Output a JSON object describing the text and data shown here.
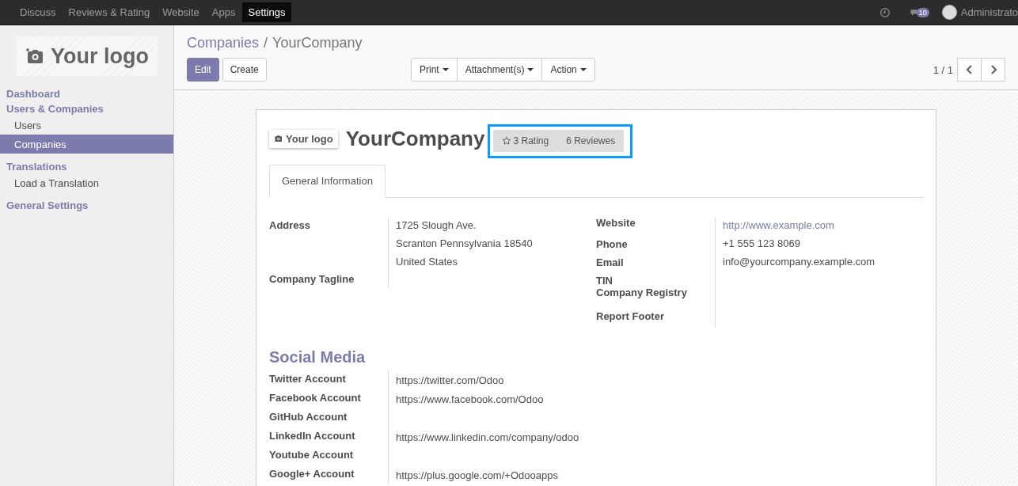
{
  "top_menu": [
    {
      "label": "Discuss",
      "selected": false
    },
    {
      "label": "Reviews & Rating",
      "selected": false
    },
    {
      "label": "Website",
      "selected": false
    },
    {
      "label": "Apps",
      "selected": false
    },
    {
      "label": "Settings",
      "selected": true
    }
  ],
  "systray": {
    "message_count": "10",
    "user": "Administrato"
  },
  "sidebar": {
    "logo_text": "Your logo",
    "sections": [
      {
        "title": "Dashboard"
      },
      {
        "title": "Users & Companies",
        "items": [
          {
            "label": "Users",
            "selected": false
          },
          {
            "label": "Companies",
            "selected": true
          }
        ]
      },
      {
        "title": "Translations",
        "items": [
          {
            "label": "Load a Translation",
            "selected": false
          }
        ]
      },
      {
        "title": "General Settings"
      }
    ]
  },
  "breadcrumb": {
    "parent": "Companies",
    "separator": "/",
    "current": "YourCompany"
  },
  "buttons": [
    "Edit",
    "Create"
  ],
  "dropdowns": [
    "Print",
    "Attachment(s)",
    "Action"
  ],
  "pager": "1 / 1",
  "form": {
    "logo_text": "Your logo",
    "name": "YourCompany",
    "stat_buttons": [
      {
        "kind": "star",
        "label": "3 Rating"
      },
      {
        "kind": "plain",
        "label": "6 Reviewes"
      }
    ],
    "tabs": [
      {
        "label": "General Information",
        "selected": true
      }
    ],
    "left_fields": [
      {
        "label": "Address",
        "values": [
          "1725 Slough Ave.",
          "Scranton Pennsylvania 18540",
          "United States"
        ]
      },
      {
        "label": "Company Tagline"
      }
    ],
    "right_fields": [
      {
        "label": "Website",
        "values": [
          "http://www.example.com"
        ],
        "link": true
      },
      {
        "label": "Phone",
        "values": [
          "+1 555 123 8069"
        ],
        "link": false
      },
      {
        "label": "Email",
        "values": [
          "info@yourcompany.example.com"
        ],
        "link": false
      },
      {
        "label": "TIN"
      },
      {
        "label": "Company Registry"
      },
      {
        "label": "Report Footer"
      }
    ],
    "social_title": "Social Media",
    "social": [
      {
        "label": "Twitter Account",
        "value": "https://twitter.com/Odoo"
      },
      {
        "label": "Facebook Account",
        "value": "https://www.facebook.com/Odoo"
      },
      {
        "label": "GitHub Account"
      },
      {
        "label": "LinkedIn Account",
        "value": "https://www.linkedin.com/company/odoo"
      },
      {
        "label": "Youtube Account"
      },
      {
        "label": "Google+ Account",
        "value": "https://plus.google.com/+Odooapps"
      }
    ]
  }
}
